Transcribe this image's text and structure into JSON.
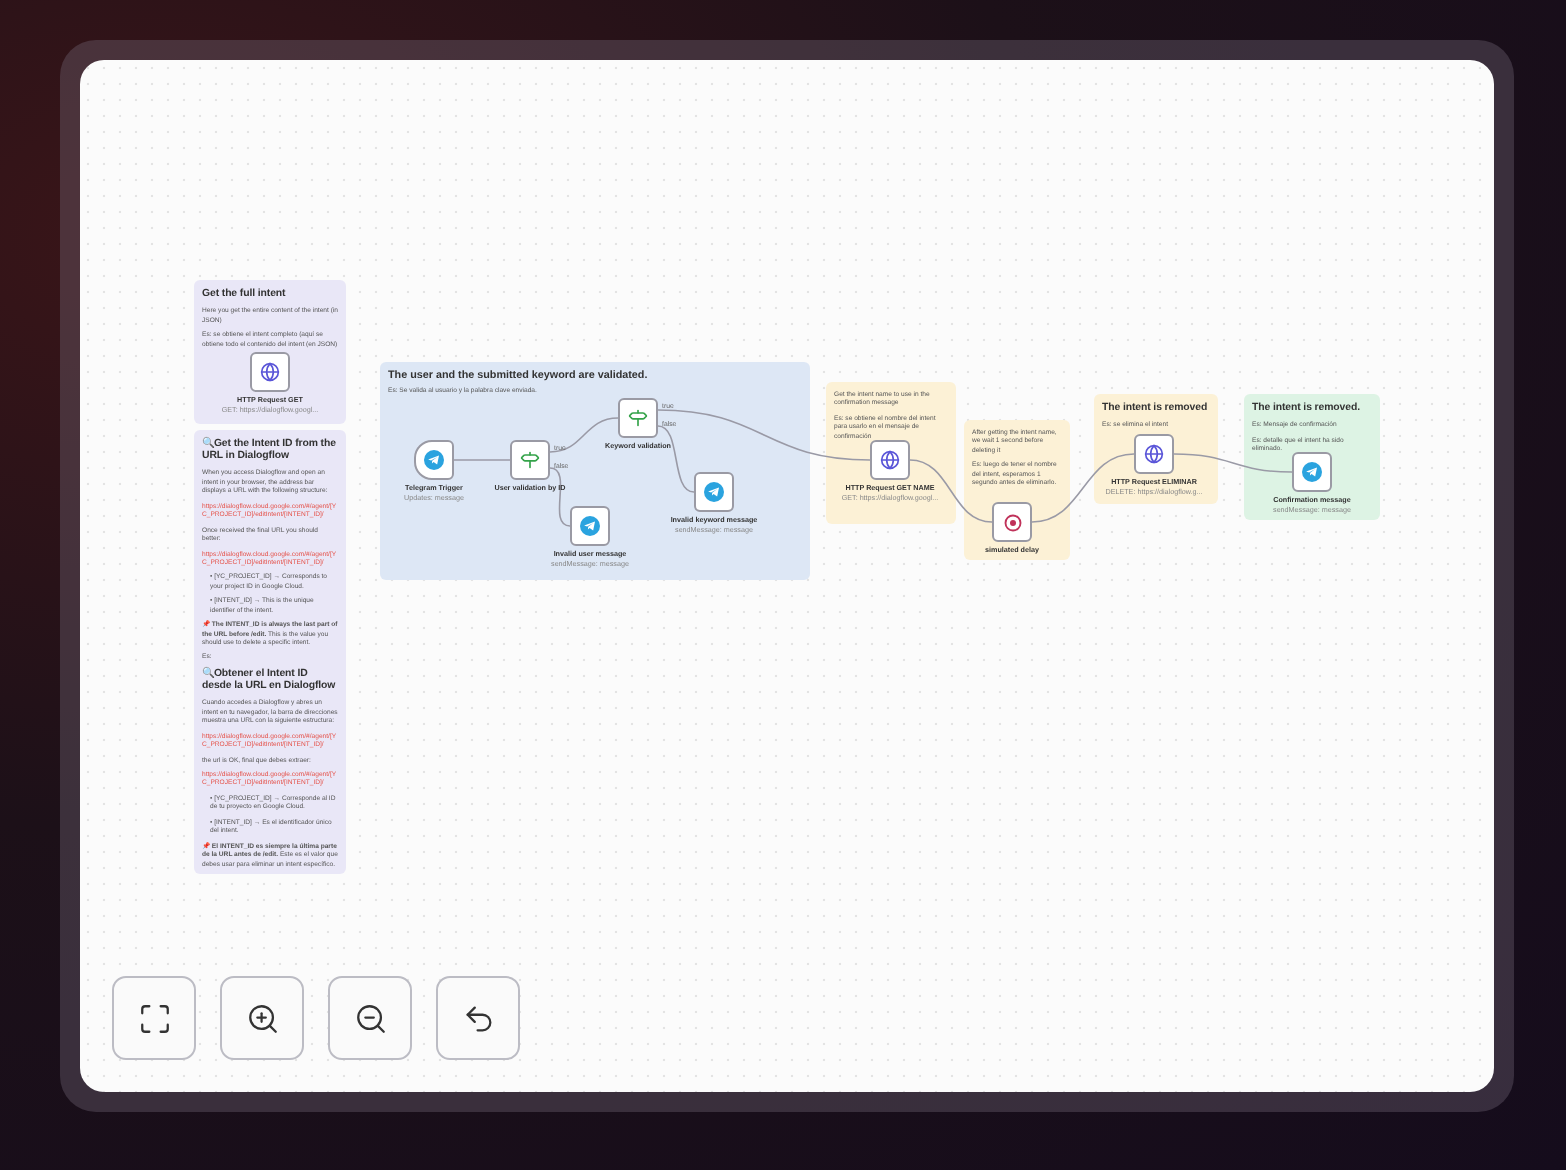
{
  "notes": [
    {
      "color": "#e9e7f7",
      "blocks": [
        {
          "kind": "heading",
          "text": "Get the full intent"
        },
        {
          "kind": "text",
          "text": "Here you get the entire content of the intent (in JSON)"
        },
        {
          "kind": "text",
          "text": "Es: se obtiene el intent completo (aquí se obtiene todo el contenido del intent (en JSON)"
        }
      ]
    },
    {
      "color": "#e9e7f7",
      "blocks": [
        {
          "kind": "heading",
          "text": "🔍Get the **Intent ID** from the URL in Dialogflow"
        },
        {
          "kind": "text",
          "text": "When you access Dialogflow and open an intent in your browser, the address bar displays a URL with the following structure:"
        },
        {
          "kind": "link",
          "text": "https://dialogflow.cloud.google.com/#/agent/[YC_PROJECT_ID]/editIntent/[INTENT_ID]/"
        },
        {
          "kind": "text",
          "text": "Once received the final URL you should better:"
        },
        {
          "kind": "link",
          "text": "https://dialogflow.cloud.google.com/#/agent/[YC_PROJECT_ID]/editIntent/[INTENT_ID]/"
        },
        {
          "kind": "bullet",
          "text": "• [YC_PROJECT_ID] → Corresponds to your project ID in Google Cloud."
        },
        {
          "kind": "bullet",
          "text": "• [INTENT_ID] → This is the unique identifier of the intent."
        },
        {
          "kind": "text",
          "text": "📌 **The INTENT_ID is always the last part of the URL before /edit.** This is the value you should use to delete a specific intent."
        },
        {
          "kind": "text",
          "text": "Es:"
        },
        {
          "kind": "heading",
          "text": "🔍Obtener el **Intent ID** desde la URL en Dialogflow"
        },
        {
          "kind": "text",
          "text": "Cuando accedes a Dialogflow y abres un intent en tu navegador, la barra de direcciones muestra una URL con la siguiente estructura:"
        },
        {
          "kind": "link",
          "text": "https://dialogflow.cloud.google.com/#/agent/[YC_PROJECT_ID]/editIntent/[INTENT_ID]/"
        },
        {
          "kind": "text",
          "text": "the url is OK, final que debes extraer:"
        },
        {
          "kind": "link",
          "text": "https://dialogflow.cloud.google.com/#/agent/[YC_PROJECT_ID]/editIntent/[INTENT_ID]/"
        },
        {
          "kind": "bullet",
          "text": "• [YC_PROJECT_ID] → Corresponde al ID de tu proyecto en Google Cloud."
        },
        {
          "kind": "bullet",
          "text": "• [INTENT_ID] → Es el identificador único del intent."
        },
        {
          "kind": "text",
          "text": "📌 **El INTENT_ID es siempre la última parte de la URL antes de /edit.** Este es el valor que debes usar para eliminar un intent específico."
        }
      ]
    },
    {
      "color": "#fcf1d6",
      "blocks": [
        {
          "kind": "text",
          "text": "Get the intent name to use in the confirmation message"
        },
        {
          "kind": "text",
          "text": "Es: se obtiene el nombre del intent para usarlo en el mensaje de confirmación"
        }
      ]
    },
    {
      "color": "#fcf1d6",
      "blocks": [
        {
          "kind": "text",
          "text": "After getting the intent name, we wait 1 second before deleting it"
        },
        {
          "kind": "text",
          "text": "Es: luego de tener el nombre del intent, esperamos 1 segundo antes de eliminarlo."
        }
      ]
    },
    {
      "color": "#fcf1d6",
      "blocks": [
        {
          "kind": "heading",
          "text": "The intent is removed"
        },
        {
          "kind": "text",
          "text": "Es: se elimina el intent"
        }
      ]
    },
    {
      "color": "#ddf3e4",
      "blocks": [
        {
          "kind": "heading",
          "text": "The intent is removed."
        },
        {
          "kind": "text",
          "text": "Es: Mensaje de confirmación"
        },
        {
          "kind": "text",
          "text": "Es: detalle que el intent ha sido eliminado."
        }
      ]
    }
  ],
  "group": {
    "title": "The user and the submitted keyword are validated.",
    "subtitle": "Es: Se valida al usuario y la palabra clave enviada."
  },
  "nodes": [
    {
      "kind": "http",
      "label": "HTTP Request GET",
      "subtitle": "GET: https://dialogflow.googl..."
    },
    {
      "kind": "trigger",
      "label": "Telegram Trigger",
      "subtitle": "Updates: message"
    },
    {
      "kind": "if",
      "label": "User validation by ID",
      "outputs": [
        "true",
        "false"
      ]
    },
    {
      "kind": "if",
      "label": "Keyword validation",
      "outputs": [
        "true",
        "false"
      ]
    },
    {
      "kind": "telegram",
      "label": "Invalid user message",
      "subtitle": "sendMessage: message"
    },
    {
      "kind": "telegram",
      "label": "Invalid keyword message",
      "subtitle": "sendMessage: message"
    },
    {
      "kind": "http",
      "label": "HTTP Request GET NAME",
      "subtitle": "GET: https://dialogflow.googl..."
    },
    {
      "kind": "wait",
      "label": "simulated delay"
    },
    {
      "kind": "http",
      "label": "HTTP Request ELIMINAR",
      "subtitle": "DELETE: https://dialogflow.g..."
    },
    {
      "kind": "telegram",
      "label": "Confirmation message",
      "subtitle": "sendMessage: message"
    }
  ],
  "controls": [
    {
      "kind": "fit"
    },
    {
      "kind": "zoom-in"
    },
    {
      "kind": "zoom-out"
    },
    {
      "kind": "undo"
    }
  ]
}
